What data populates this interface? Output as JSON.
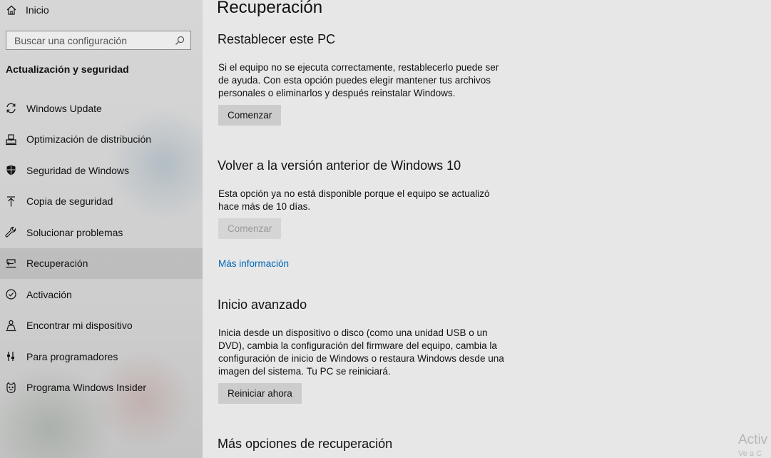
{
  "sidebar": {
    "home_label": "Inicio",
    "search_placeholder": "Buscar una configuración",
    "section_title": "Actualización y seguridad",
    "items": [
      {
        "label": "Windows Update",
        "icon": "refresh-icon"
      },
      {
        "label": "Optimización de distribución",
        "icon": "delivery-icon"
      },
      {
        "label": "Seguridad de Windows",
        "icon": "shield-icon"
      },
      {
        "label": "Copia de seguridad",
        "icon": "backup-icon"
      },
      {
        "label": "Solucionar problemas",
        "icon": "wrench-icon"
      },
      {
        "label": "Recuperación",
        "icon": "recovery-icon",
        "active": true
      },
      {
        "label": "Activación",
        "icon": "check-circle-icon"
      },
      {
        "label": "Encontrar mi dispositivo",
        "icon": "person-locate-icon"
      },
      {
        "label": "Para programadores",
        "icon": "developer-icon"
      },
      {
        "label": "Programa Windows Insider",
        "icon": "insider-icon"
      }
    ]
  },
  "main": {
    "page_title": "Recuperación",
    "reset": {
      "heading": "Restablecer este PC",
      "description": "Si el equipo no se ejecuta correctamente, restablecerlo puede ser de ayuda. Con esta opción puedes elegir mantener tus archivos personales o eliminarlos y después reinstalar Windows.",
      "button": "Comenzar"
    },
    "go_back": {
      "heading": "Volver a la versión anterior de Windows 10",
      "description": "Esta opción ya no está disponible porque el equipo se actualizó hace más de 10 días.",
      "button": "Comenzar",
      "link": "Más información"
    },
    "advanced": {
      "heading": "Inicio avanzado",
      "description": "Inicia desde un dispositivo o disco (como una unidad USB o un DVD), cambia la configuración del firmware del equipo, cambia la configuración de inicio de Windows o restaura Windows desde una imagen del sistema. Tu PC se reiniciará.",
      "button": "Reiniciar ahora"
    },
    "more_options_heading": "Más opciones de recuperación"
  },
  "watermark": {
    "line1": "Activ",
    "line2": "Ve a C"
  },
  "colors": {
    "link": "#0067b8",
    "active_item_bg": "#b0b0b0"
  }
}
